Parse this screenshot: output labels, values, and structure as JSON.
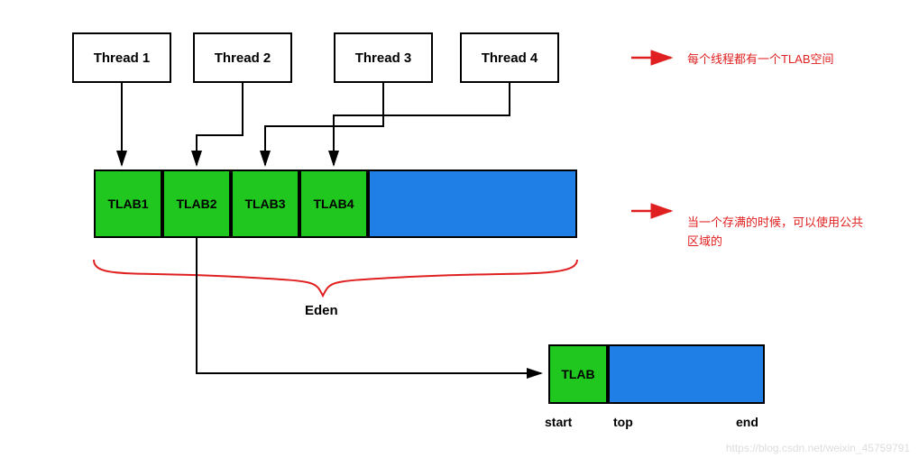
{
  "threads": {
    "t1": "Thread 1",
    "t2": "Thread 2",
    "t3": "Thread 3",
    "t4": "Thread 4"
  },
  "tlabs": {
    "b1": "TLAB1",
    "b2": "TLAB2",
    "b3": "TLAB3",
    "b4": "TLAB4"
  },
  "eden_label": "Eden",
  "detail": {
    "tlab": "TLAB",
    "start": "start",
    "top": "top",
    "end": "end"
  },
  "annotations": {
    "top": "每个线程都有一个TLAB空间",
    "mid_line1": "当一个存满的时候，可以使用公共",
    "mid_line2": "区域的"
  },
  "watermark": "https://blog.csdn.net/weixin_45759791",
  "chart_data": {
    "type": "diagram",
    "title": "TLAB allocation in Eden space",
    "threads": [
      "Thread 1",
      "Thread 2",
      "Thread 3",
      "Thread 4"
    ],
    "eden_blocks": [
      "TLAB1",
      "TLAB2",
      "TLAB3",
      "TLAB4",
      "shared_region"
    ],
    "tlab_detail_markers": [
      "start",
      "top",
      "end"
    ],
    "annotations": [
      "每个线程都有一个TLAB空间",
      "当一个存满的时候，可以使用公共区域的"
    ],
    "region_label": "Eden"
  }
}
